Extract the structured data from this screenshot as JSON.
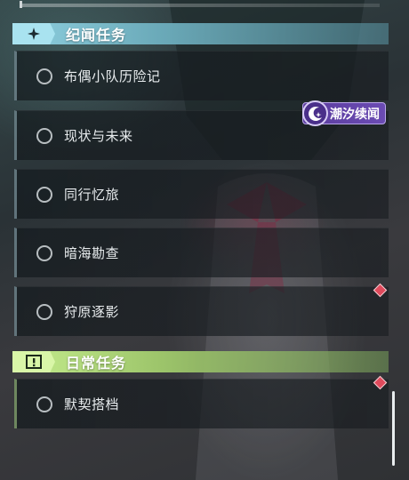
{
  "sections": [
    {
      "id": "lore",
      "title": "纪闻任务",
      "icon": "sparkle-icon",
      "accent": "#8fd0e0",
      "quests": [
        {
          "name": "布偶小队历险记",
          "completed": false
        },
        {
          "name": "现状与未来",
          "completed": false
        },
        {
          "name": "同行忆旅",
          "completed": false
        },
        {
          "name": "暗海勘查",
          "completed": false
        },
        {
          "name": "狩原逐影",
          "completed": false
        }
      ]
    },
    {
      "id": "daily",
      "title": "日常任务",
      "icon": "exclamation-box-icon",
      "accent": "#c6ee8e",
      "quests": [
        {
          "name": "默契搭档",
          "completed": false
        }
      ]
    }
  ],
  "event_badge": {
    "label": "潮汐续闻",
    "icon": "crescent-star-icon",
    "color": "#5b3d9e"
  },
  "markers": {
    "icon": "red-diamond-icon",
    "color": "#e04a5c"
  }
}
